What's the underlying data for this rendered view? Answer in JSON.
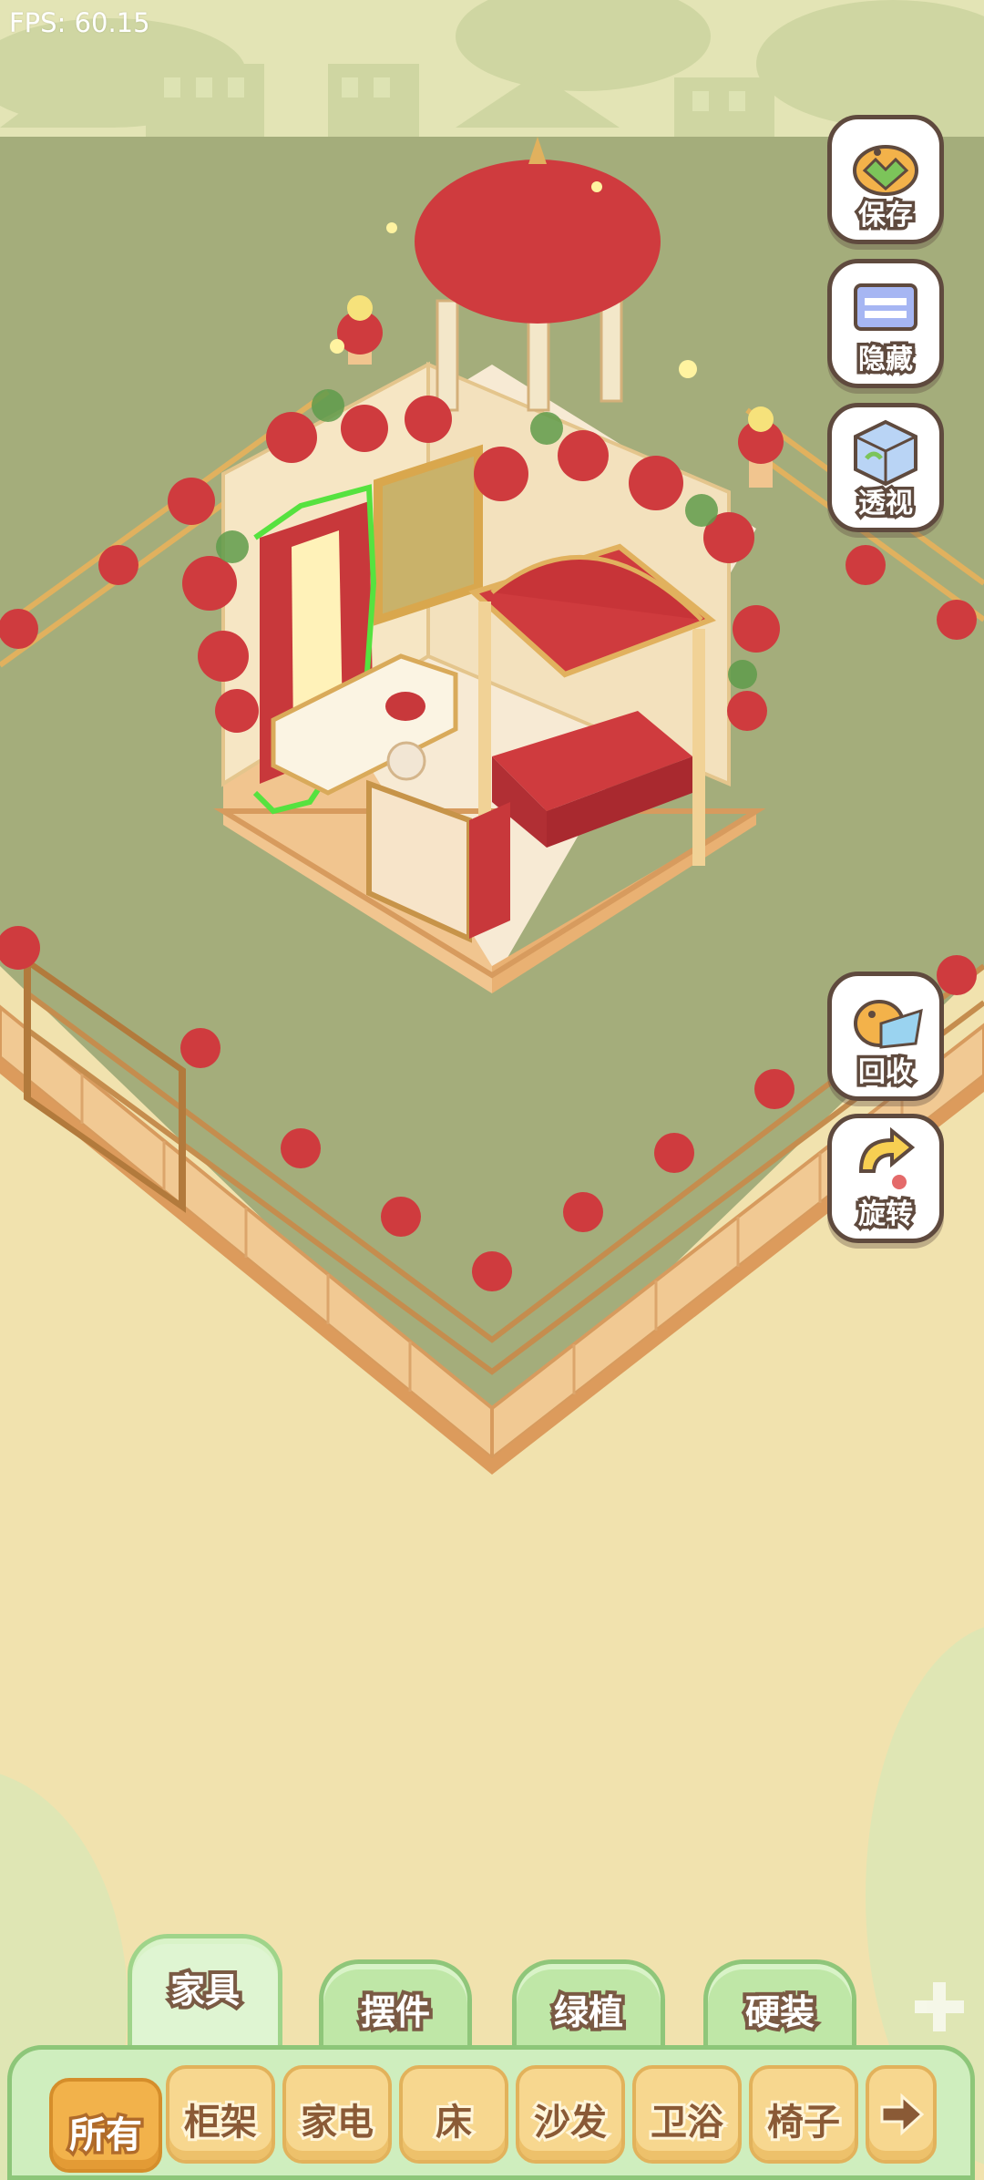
{
  "hud": {
    "fps": "FPS: 60.15"
  },
  "actions": {
    "save": "保存",
    "hide": "隐藏",
    "xray": "透视",
    "recycle": "回收",
    "rotate": "旋转"
  },
  "tabs": [
    "家具",
    "摆件",
    "绿植",
    "硬装"
  ],
  "active_tab": "家具",
  "categories": [
    "所有",
    "柜架",
    "家电",
    "床",
    "沙发",
    "卫浴",
    "椅子"
  ],
  "active_category": "所有",
  "icons": {
    "next": "arrow-right-icon",
    "save": "duck-save-icon",
    "hide": "hide-frame-icon",
    "xray": "glass-cube-icon",
    "recycle": "duck-recycle-icon",
    "rotate": "rotate-icon"
  },
  "colors": {
    "sky": "#e3e4b5",
    "lawn": "#a4ad7b",
    "floor_tile": "#f1c993",
    "rose": "#cf3b3e",
    "gold": "#e1b15e",
    "selection_outline": "#56e23f",
    "outline_brown": "#5f4a3e",
    "tab_green": "#bfe7a7"
  }
}
